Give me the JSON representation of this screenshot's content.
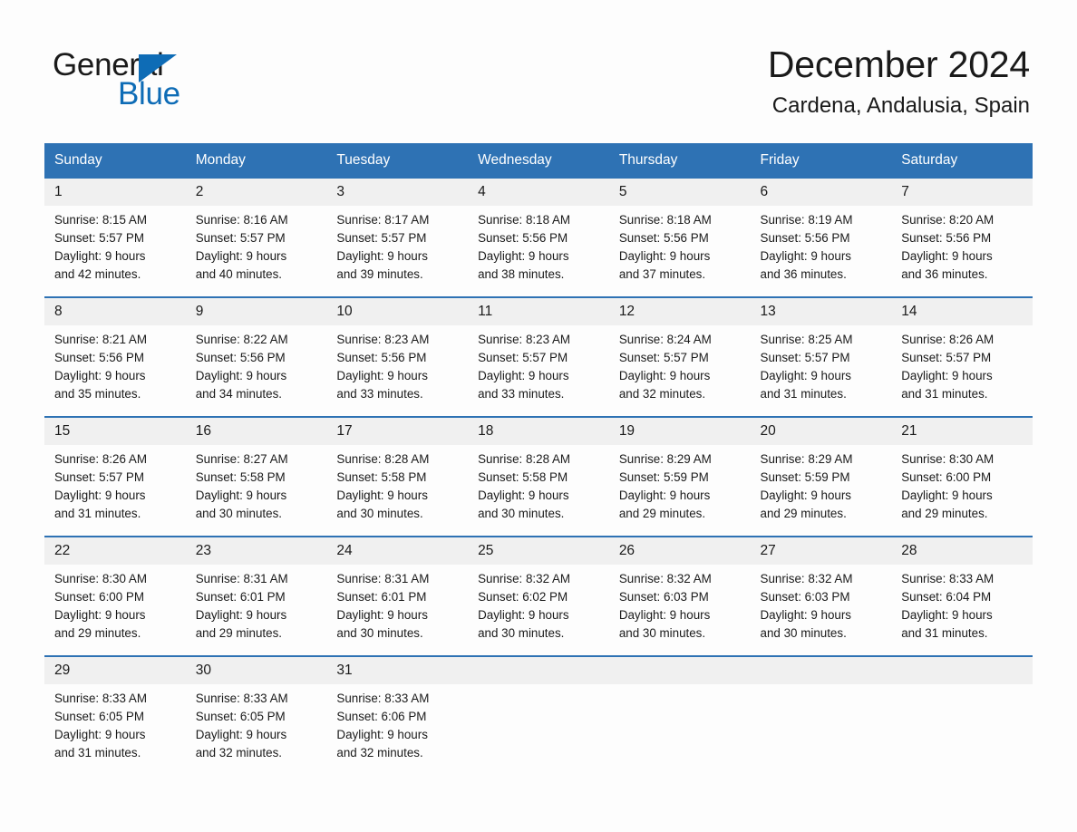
{
  "brand": {
    "name_part1": "General",
    "name_part2": "Blue",
    "accent_color": "#0e6cb6"
  },
  "header": {
    "title": "December 2024",
    "subtitle": "Cardena, Andalusia, Spain",
    "header_bg_color": "#2e72b4",
    "daynum_bg_color": "#f0f0f0"
  },
  "weekday_headers": [
    "Sunday",
    "Monday",
    "Tuesday",
    "Wednesday",
    "Thursday",
    "Friday",
    "Saturday"
  ],
  "weeks": [
    {
      "days": [
        {
          "num": "1",
          "sunrise": "Sunrise: 8:15 AM",
          "sunset": "Sunset: 5:57 PM",
          "daylight_1": "Daylight: 9 hours",
          "daylight_2": "and 42 minutes."
        },
        {
          "num": "2",
          "sunrise": "Sunrise: 8:16 AM",
          "sunset": "Sunset: 5:57 PM",
          "daylight_1": "Daylight: 9 hours",
          "daylight_2": "and 40 minutes."
        },
        {
          "num": "3",
          "sunrise": "Sunrise: 8:17 AM",
          "sunset": "Sunset: 5:57 PM",
          "daylight_1": "Daylight: 9 hours",
          "daylight_2": "and 39 minutes."
        },
        {
          "num": "4",
          "sunrise": "Sunrise: 8:18 AM",
          "sunset": "Sunset: 5:56 PM",
          "daylight_1": "Daylight: 9 hours",
          "daylight_2": "and 38 minutes."
        },
        {
          "num": "5",
          "sunrise": "Sunrise: 8:18 AM",
          "sunset": "Sunset: 5:56 PM",
          "daylight_1": "Daylight: 9 hours",
          "daylight_2": "and 37 minutes."
        },
        {
          "num": "6",
          "sunrise": "Sunrise: 8:19 AM",
          "sunset": "Sunset: 5:56 PM",
          "daylight_1": "Daylight: 9 hours",
          "daylight_2": "and 36 minutes."
        },
        {
          "num": "7",
          "sunrise": "Sunrise: 8:20 AM",
          "sunset": "Sunset: 5:56 PM",
          "daylight_1": "Daylight: 9 hours",
          "daylight_2": "and 36 minutes."
        }
      ]
    },
    {
      "days": [
        {
          "num": "8",
          "sunrise": "Sunrise: 8:21 AM",
          "sunset": "Sunset: 5:56 PM",
          "daylight_1": "Daylight: 9 hours",
          "daylight_2": "and 35 minutes."
        },
        {
          "num": "9",
          "sunrise": "Sunrise: 8:22 AM",
          "sunset": "Sunset: 5:56 PM",
          "daylight_1": "Daylight: 9 hours",
          "daylight_2": "and 34 minutes."
        },
        {
          "num": "10",
          "sunrise": "Sunrise: 8:23 AM",
          "sunset": "Sunset: 5:56 PM",
          "daylight_1": "Daylight: 9 hours",
          "daylight_2": "and 33 minutes."
        },
        {
          "num": "11",
          "sunrise": "Sunrise: 8:23 AM",
          "sunset": "Sunset: 5:57 PM",
          "daylight_1": "Daylight: 9 hours",
          "daylight_2": "and 33 minutes."
        },
        {
          "num": "12",
          "sunrise": "Sunrise: 8:24 AM",
          "sunset": "Sunset: 5:57 PM",
          "daylight_1": "Daylight: 9 hours",
          "daylight_2": "and 32 minutes."
        },
        {
          "num": "13",
          "sunrise": "Sunrise: 8:25 AM",
          "sunset": "Sunset: 5:57 PM",
          "daylight_1": "Daylight: 9 hours",
          "daylight_2": "and 31 minutes."
        },
        {
          "num": "14",
          "sunrise": "Sunrise: 8:26 AM",
          "sunset": "Sunset: 5:57 PM",
          "daylight_1": "Daylight: 9 hours",
          "daylight_2": "and 31 minutes."
        }
      ]
    },
    {
      "days": [
        {
          "num": "15",
          "sunrise": "Sunrise: 8:26 AM",
          "sunset": "Sunset: 5:57 PM",
          "daylight_1": "Daylight: 9 hours",
          "daylight_2": "and 31 minutes."
        },
        {
          "num": "16",
          "sunrise": "Sunrise: 8:27 AM",
          "sunset": "Sunset: 5:58 PM",
          "daylight_1": "Daylight: 9 hours",
          "daylight_2": "and 30 minutes."
        },
        {
          "num": "17",
          "sunrise": "Sunrise: 8:28 AM",
          "sunset": "Sunset: 5:58 PM",
          "daylight_1": "Daylight: 9 hours",
          "daylight_2": "and 30 minutes."
        },
        {
          "num": "18",
          "sunrise": "Sunrise: 8:28 AM",
          "sunset": "Sunset: 5:58 PM",
          "daylight_1": "Daylight: 9 hours",
          "daylight_2": "and 30 minutes."
        },
        {
          "num": "19",
          "sunrise": "Sunrise: 8:29 AM",
          "sunset": "Sunset: 5:59 PM",
          "daylight_1": "Daylight: 9 hours",
          "daylight_2": "and 29 minutes."
        },
        {
          "num": "20",
          "sunrise": "Sunrise: 8:29 AM",
          "sunset": "Sunset: 5:59 PM",
          "daylight_1": "Daylight: 9 hours",
          "daylight_2": "and 29 minutes."
        },
        {
          "num": "21",
          "sunrise": "Sunrise: 8:30 AM",
          "sunset": "Sunset: 6:00 PM",
          "daylight_1": "Daylight: 9 hours",
          "daylight_2": "and 29 minutes."
        }
      ]
    },
    {
      "days": [
        {
          "num": "22",
          "sunrise": "Sunrise: 8:30 AM",
          "sunset": "Sunset: 6:00 PM",
          "daylight_1": "Daylight: 9 hours",
          "daylight_2": "and 29 minutes."
        },
        {
          "num": "23",
          "sunrise": "Sunrise: 8:31 AM",
          "sunset": "Sunset: 6:01 PM",
          "daylight_1": "Daylight: 9 hours",
          "daylight_2": "and 29 minutes."
        },
        {
          "num": "24",
          "sunrise": "Sunrise: 8:31 AM",
          "sunset": "Sunset: 6:01 PM",
          "daylight_1": "Daylight: 9 hours",
          "daylight_2": "and 30 minutes."
        },
        {
          "num": "25",
          "sunrise": "Sunrise: 8:32 AM",
          "sunset": "Sunset: 6:02 PM",
          "daylight_1": "Daylight: 9 hours",
          "daylight_2": "and 30 minutes."
        },
        {
          "num": "26",
          "sunrise": "Sunrise: 8:32 AM",
          "sunset": "Sunset: 6:03 PM",
          "daylight_1": "Daylight: 9 hours",
          "daylight_2": "and 30 minutes."
        },
        {
          "num": "27",
          "sunrise": "Sunrise: 8:32 AM",
          "sunset": "Sunset: 6:03 PM",
          "daylight_1": "Daylight: 9 hours",
          "daylight_2": "and 30 minutes."
        },
        {
          "num": "28",
          "sunrise": "Sunrise: 8:33 AM",
          "sunset": "Sunset: 6:04 PM",
          "daylight_1": "Daylight: 9 hours",
          "daylight_2": "and 31 minutes."
        }
      ]
    },
    {
      "days": [
        {
          "num": "29",
          "sunrise": "Sunrise: 8:33 AM",
          "sunset": "Sunset: 6:05 PM",
          "daylight_1": "Daylight: 9 hours",
          "daylight_2": "and 31 minutes."
        },
        {
          "num": "30",
          "sunrise": "Sunrise: 8:33 AM",
          "sunset": "Sunset: 6:05 PM",
          "daylight_1": "Daylight: 9 hours",
          "daylight_2": "and 32 minutes."
        },
        {
          "num": "31",
          "sunrise": "Sunrise: 8:33 AM",
          "sunset": "Sunset: 6:06 PM",
          "daylight_1": "Daylight: 9 hours",
          "daylight_2": "and 32 minutes."
        },
        {
          "num": "",
          "sunrise": "",
          "sunset": "",
          "daylight_1": "",
          "daylight_2": ""
        },
        {
          "num": "",
          "sunrise": "",
          "sunset": "",
          "daylight_1": "",
          "daylight_2": ""
        },
        {
          "num": "",
          "sunrise": "",
          "sunset": "",
          "daylight_1": "",
          "daylight_2": ""
        },
        {
          "num": "",
          "sunrise": "",
          "sunset": "",
          "daylight_1": "",
          "daylight_2": ""
        }
      ]
    }
  ]
}
